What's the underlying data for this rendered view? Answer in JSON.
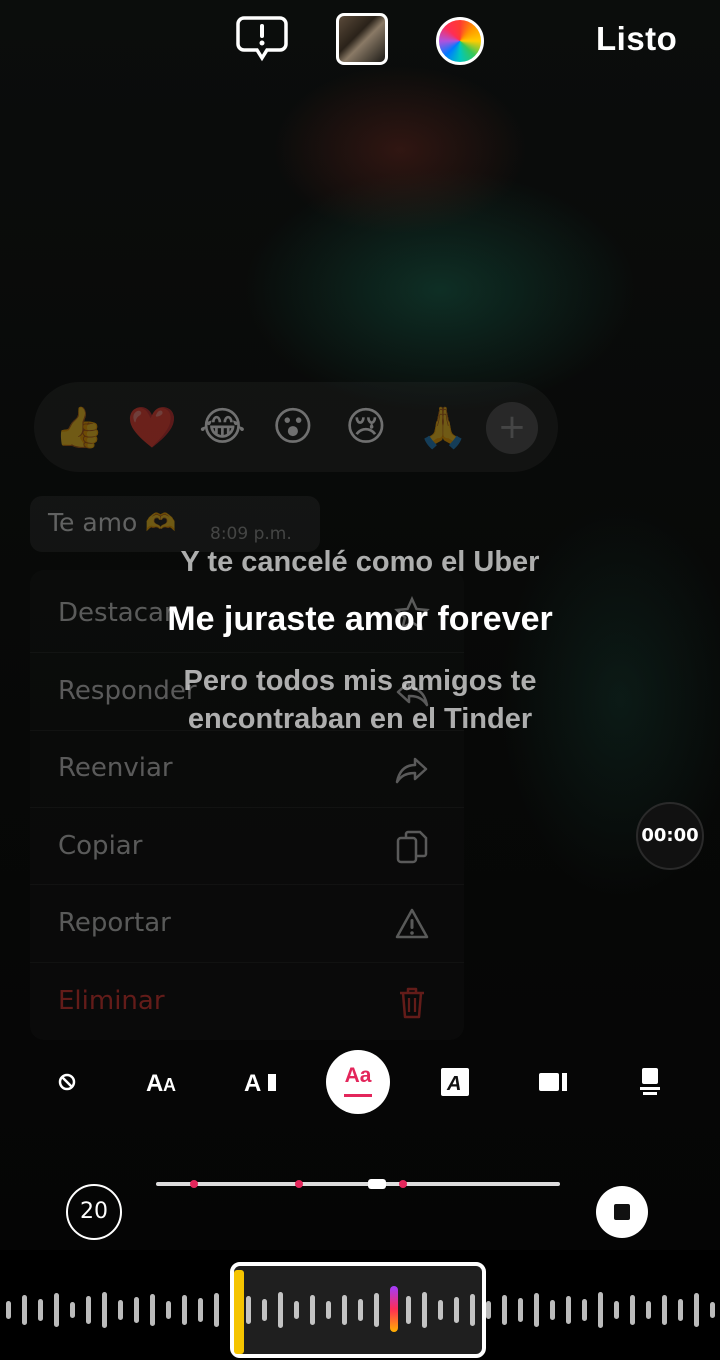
{
  "topbar": {
    "alert_icon": "exclamation-bubble-icon",
    "thumbnail": "album-cover-thumbnail",
    "color_picker": "color-wheel-icon",
    "done_label": "Listo"
  },
  "reactions": {
    "emojis": [
      "👍",
      "❤️",
      "😂",
      "😮",
      "😢",
      "🙏"
    ],
    "add_label": "+"
  },
  "message": {
    "text": "Te amo 🫶",
    "time": "8:09 p.m."
  },
  "menu": {
    "items": [
      {
        "label": "Destacar",
        "icon": "star-icon"
      },
      {
        "label": "Responder",
        "icon": "reply-icon"
      },
      {
        "label": "Reenviar",
        "icon": "forward-icon"
      },
      {
        "label": "Copiar",
        "icon": "copy-icon"
      },
      {
        "label": "Reportar",
        "icon": "warning-icon"
      },
      {
        "label": "Eliminar",
        "icon": "trash-icon",
        "color": "#e53935"
      }
    ]
  },
  "lyrics": {
    "previous": "Y te cancelé como el Uber",
    "current": "Me juraste amor forever",
    "next_line1": "Pero todos mis amigos te",
    "next_line2": "encontraban en el Tinder"
  },
  "timer": "00:00",
  "toolbar": {
    "tools": [
      "none-icon",
      "size-aa-icon",
      "font-ai-icon",
      "style-aa-icon",
      "italic-a-icon",
      "camera-icon",
      "layout-icon"
    ],
    "selected_label": "Aa",
    "selected_index": 3
  },
  "slider": {
    "markers": [
      0.09,
      0.35,
      0.61
    ],
    "position": 0.55
  },
  "speed_label": "20",
  "colors": {
    "accent": "#e3265b",
    "danger": "#e53935",
    "scrub_edge": "#f5c400"
  }
}
